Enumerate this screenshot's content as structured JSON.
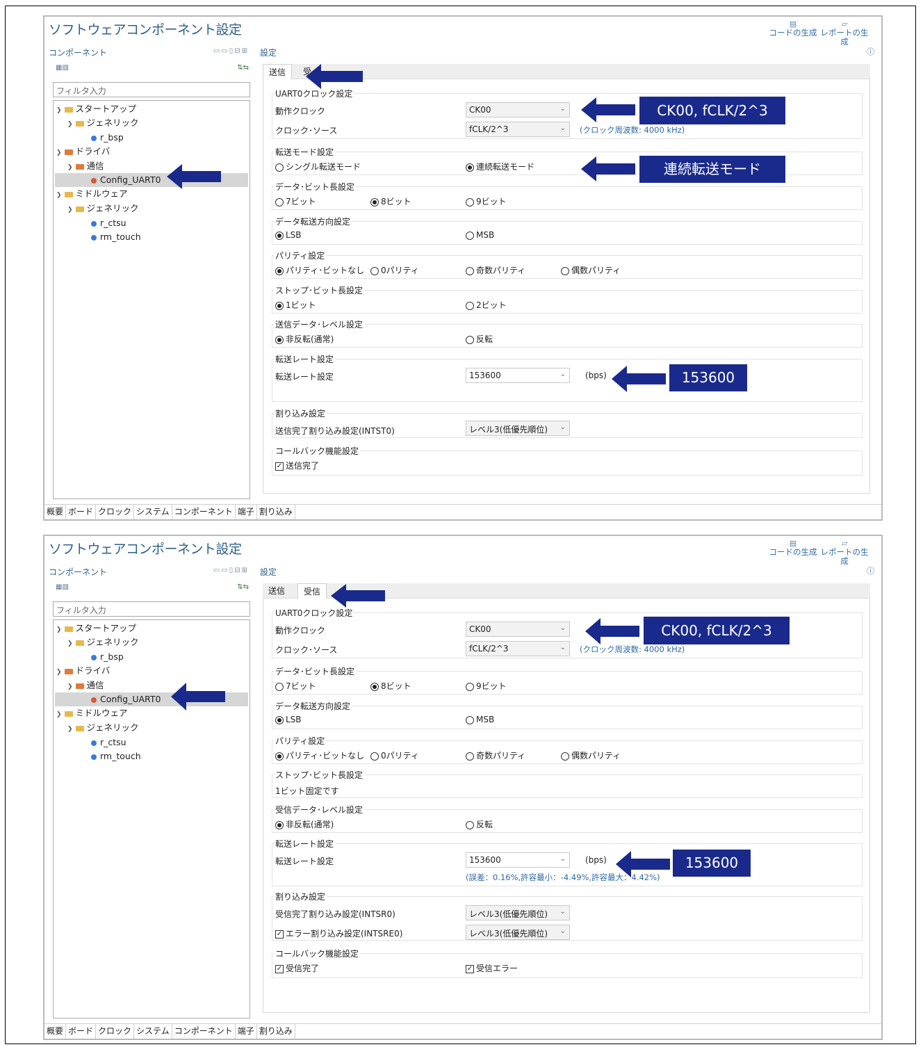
{
  "title": "ソフトウェアコンポーネント設定",
  "toolbar": {
    "generate_code": "コードの生成",
    "generate_report": "レポートの生成"
  },
  "left": {
    "header": "コンポーネント",
    "filter_placeholder": "フィルタ入力",
    "tree": {
      "startup": "スタートアップ",
      "generic1": "ジェネリック",
      "r_bsp": "r_bsp",
      "driver": "ドライバ",
      "comm": "通信",
      "config_uart0": "Config_UART0",
      "middleware": "ミドルウェア",
      "generic2": "ジェネリック",
      "r_ctsu": "r_ctsu",
      "rm_touch": "rm_touch"
    }
  },
  "right": {
    "header": "設定"
  },
  "bottom_tabs": [
    "概要",
    "ボード",
    "クロック",
    "システム",
    "コンポーネント",
    "端子",
    "割り込み"
  ],
  "tx": {
    "tab_send": "送信",
    "tab_recv": "受",
    "clock_group": "UART0クロック設定",
    "op_clock_label": "動作クロック",
    "op_clock_value": "CK00",
    "clock_source_label": "クロック･ソース",
    "clock_source_value": "fCLK/2^3",
    "clock_freq_note": "(クロック周波数: 4000 kHz)",
    "mode_group": "転送モード設定",
    "mode_single": "シングル転送モード",
    "mode_continuous": "連続転送モード",
    "bitlen_group": "データ･ビット長設定",
    "bit7": "7ビット",
    "bit8": "8ビット",
    "bit9": "9ビット",
    "dir_group": "データ転送方向設定",
    "lsb": "LSB",
    "msb": "MSB",
    "parity_group": "パリティ設定",
    "parity_none": "パリティ･ビットなし",
    "parity_zero": "0パリティ",
    "parity_odd": "奇数パリティ",
    "parity_even": "偶数パリティ",
    "stop_group": "ストップ･ビット長設定",
    "stop1": "1ビット",
    "stop2": "2ビット",
    "level_group": "送信データ･レベル設定",
    "level_normal": "非反転(通常)",
    "level_invert": "反転",
    "rate_group": "転送レート設定",
    "rate_label": "転送レート設定",
    "rate_value": "153600",
    "rate_unit": "(bps)",
    "int_group": "割り込み設定",
    "int_label": "送信完了割り込み設定(INTST0)",
    "int_value": "レベル3(低優先順位)",
    "cb_group": "コールバック機能設定",
    "cb_send_done": "送信完了"
  },
  "rx": {
    "tab_send": "送信",
    "tab_recv": "受信",
    "clock_group": "UART0クロック設定",
    "op_clock_label": "動作クロック",
    "op_clock_value": "CK00",
    "clock_source_label": "クロック･ソース",
    "clock_source_value": "fCLK/2^3",
    "clock_freq_note": "(クロック周波数: 4000 kHz)",
    "bitlen_group": "データ･ビット長設定",
    "bit7": "7ビット",
    "bit8": "8ビット",
    "bit9": "9ビット",
    "dir_group": "データ転送方向設定",
    "lsb": "LSB",
    "msb": "MSB",
    "parity_group": "パリティ設定",
    "parity_none": "パリティ･ビットなし",
    "parity_zero": "0パリティ",
    "parity_odd": "奇数パリティ",
    "parity_even": "偶数パリティ",
    "stop_group": "ストップ･ビット長設定",
    "stop_fixed": "1ビット固定です",
    "level_group": "受信データ･レベル設定",
    "level_normal": "非反転(通常)",
    "level_invert": "反転",
    "rate_group": "転送レート設定",
    "rate_label": "転送レート設定",
    "rate_value": "153600",
    "rate_unit": "(bps)",
    "rate_note": "(誤差：0.16%,許容最小：-4.49%,許容最大：4.42%)",
    "int_group": "割り込み設定",
    "int_recv_label": "受信完了割り込み設定(INTSR0)",
    "int_recv_value": "レベル3(低優先順位)",
    "int_err_label": "エラー割り込み設定(INTSRE0)",
    "int_err_value": "レベル3(低優先順位)",
    "cb_group": "コールバック機能設定",
    "cb_recv_done": "受信完了",
    "cb_recv_err": "受信エラー"
  },
  "callouts": {
    "clock": "CK00, fCLK/2^3",
    "mode": "連続転送モード",
    "rate": "153600"
  },
  "colors": {
    "callout": "#1a2a8c",
    "title": "#2f5f8c"
  }
}
